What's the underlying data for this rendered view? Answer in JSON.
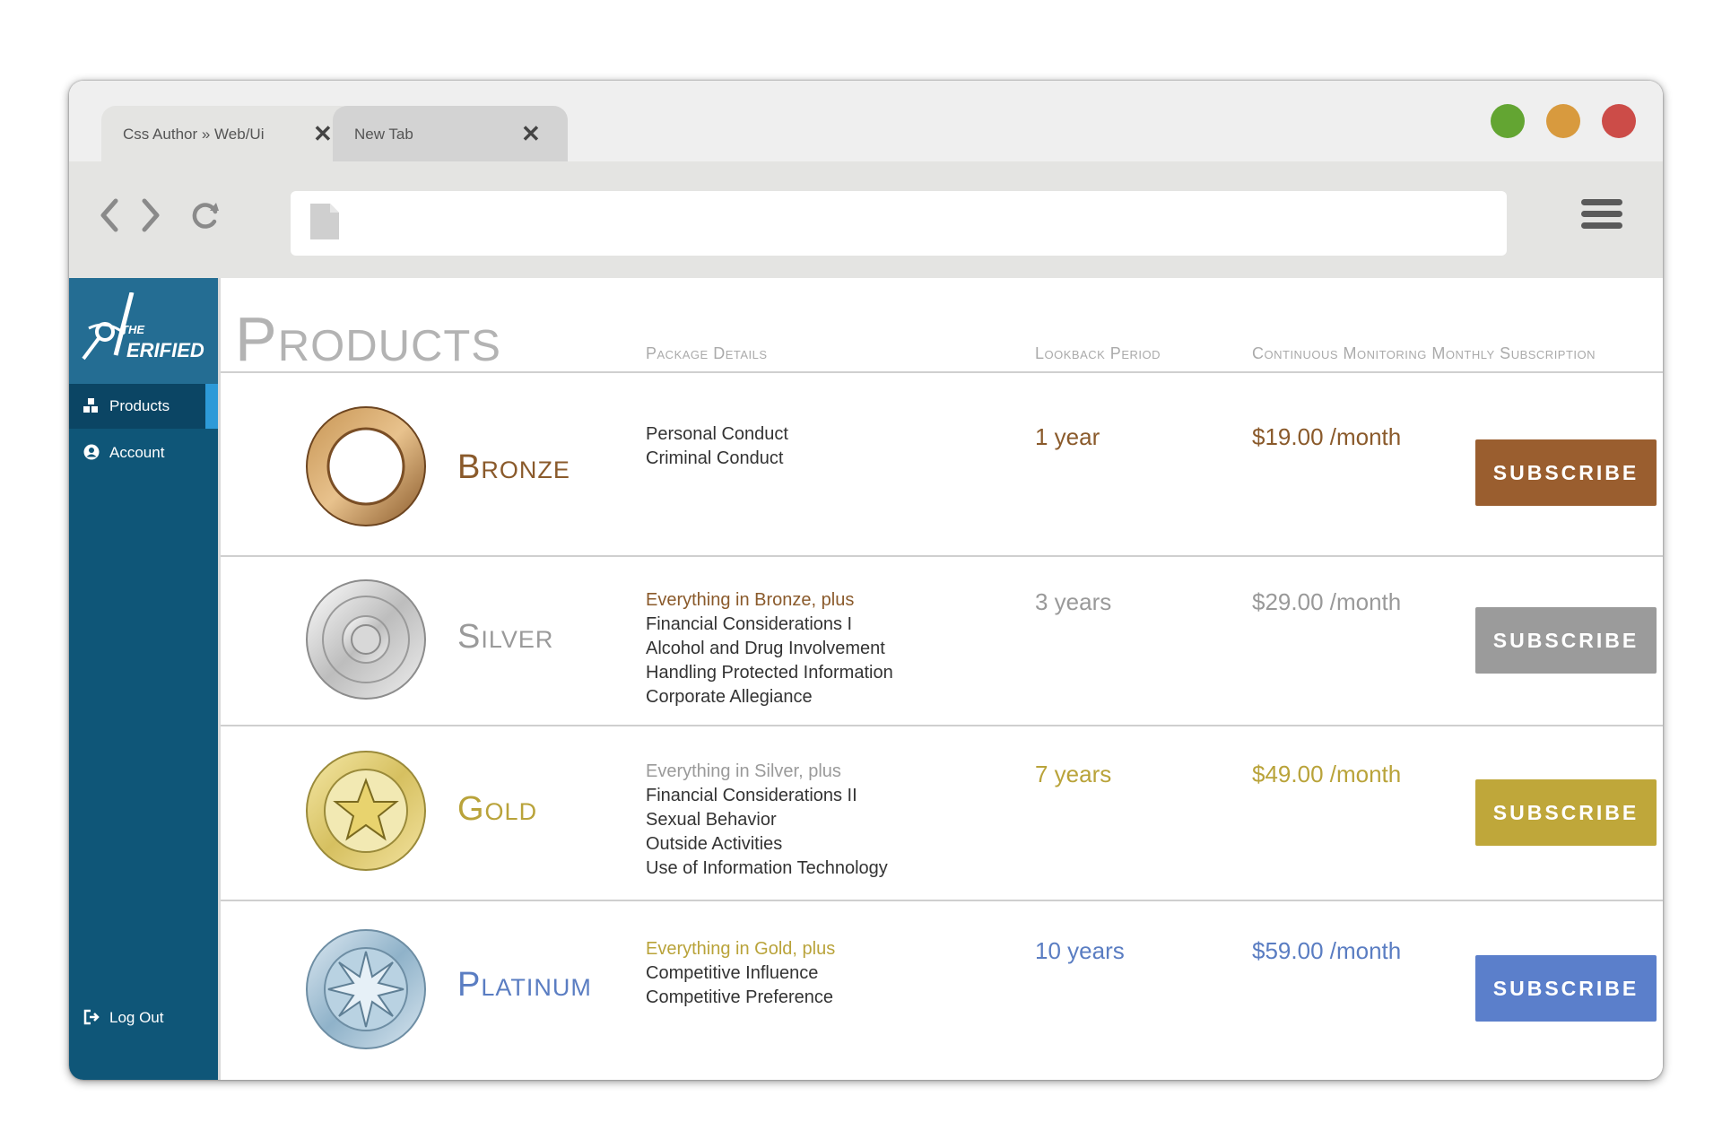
{
  "browser": {
    "tabs": [
      {
        "label": "Css Author  » Web/Ui",
        "close": "✕"
      },
      {
        "label": "New Tab",
        "close": "✕"
      }
    ],
    "address_value": ""
  },
  "sidebar": {
    "brand": "THE VERIFIED",
    "items": [
      {
        "label": "Products",
        "icon": "boxes-icon",
        "active": true
      },
      {
        "label": "Account",
        "icon": "user-circle-icon",
        "active": false
      }
    ],
    "logout": {
      "label": "Log Out",
      "icon": "sign-out-icon"
    }
  },
  "page": {
    "title": "Products",
    "columns": [
      "Package Details",
      "Lookback Period",
      "Continuous Monitoring Monthly Subscription"
    ]
  },
  "colors": {
    "bronze": "#8a5a2b",
    "silver": "#999999",
    "gold": "#b9a33a",
    "platinum": "#5a7dc2"
  },
  "products": [
    {
      "name": "Bronze",
      "details_lead": "",
      "details": [
        "Personal Conduct",
        "Criminal Conduct"
      ],
      "period": "1 year",
      "price": "$19.00 /month",
      "button": "SUBSCRIBE",
      "color": "#8a5a2b",
      "button_color": "#9a5e2f"
    },
    {
      "name": "Silver",
      "details_lead": "Everything in Bronze, plus",
      "details": [
        "Financial Considerations I",
        "Alcohol and Drug Involvement",
        "Handling Protected Information",
        "Corporate Allegiance"
      ],
      "period": "3 years",
      "price": "$29.00 /month",
      "button": "SUBSCRIBE",
      "color": "#9a9a9a",
      "button_color": "#9b9b9b"
    },
    {
      "name": "Gold",
      "details_lead": "Everything in Silver, plus",
      "details": [
        "Financial Considerations II",
        "Sexual Behavior",
        "Outside Activities",
        "Use of Information Technology"
      ],
      "period": "7 years",
      "price": "$49.00 /month",
      "button": "SUBSCRIBE",
      "color": "#b9a33a",
      "button_color": "#bfa73a"
    },
    {
      "name": "Platinum",
      "details_lead": "Everything in Gold, plus",
      "details": [
        "Competitive Influence",
        "Competitive Preference"
      ],
      "period": "10 years",
      "price": "$59.00 /month",
      "button": "SUBSCRIBE",
      "color": "#5a7dc2",
      "button_color": "#5b7fcb"
    }
  ]
}
